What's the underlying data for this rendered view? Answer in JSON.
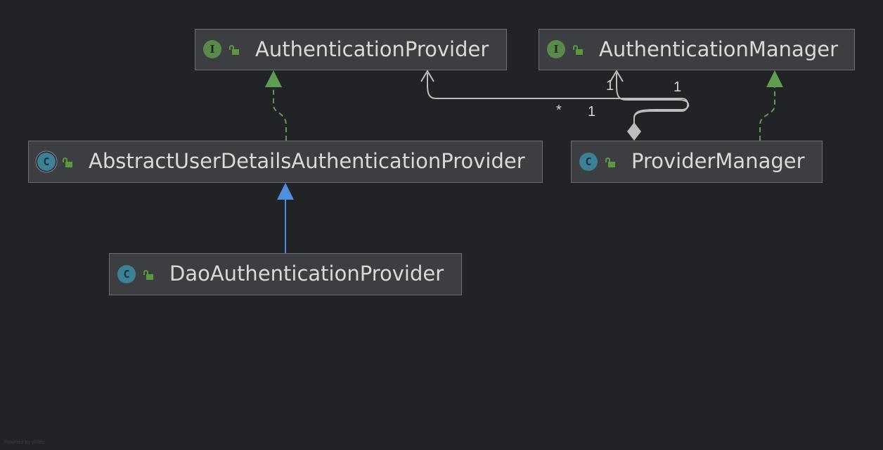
{
  "nodes": {
    "authentication_provider": {
      "kind": "interface",
      "kind_letter": "I",
      "name": "AuthenticationProvider"
    },
    "authentication_manager": {
      "kind": "interface",
      "kind_letter": "I",
      "name": "AuthenticationManager"
    },
    "abstract_user_details_authentication_provider": {
      "kind": "abstract class",
      "kind_letter": "C",
      "name": "AbstractUserDetailsAuthenticationProvider"
    },
    "provider_manager": {
      "kind": "class",
      "kind_letter": "C",
      "name": "ProviderManager"
    },
    "dao_authentication_provider": {
      "kind": "class",
      "kind_letter": "C",
      "name": "DaoAuthenticationProvider"
    }
  },
  "edges": [
    {
      "from": "abstract_user_details_authentication_provider",
      "to": "authentication_provider",
      "type": "realization"
    },
    {
      "from": "provider_manager",
      "to": "authentication_manager",
      "type": "realization"
    },
    {
      "from": "dao_authentication_provider",
      "to": "abstract_user_details_authentication_provider",
      "type": "generalization"
    },
    {
      "from": "provider_manager",
      "to": "authentication_provider",
      "type": "aggregation",
      "source_multiplicity": "1",
      "target_multiplicity": "*"
    },
    {
      "from": "provider_manager",
      "to": "authentication_manager",
      "type": "aggregation",
      "source_multiplicity": "1",
      "target_multiplicity": "1"
    }
  ],
  "multiplicities": {
    "provider_to_ap_star": "*",
    "provider_to_ap_one": "1",
    "parent_one_a": "1",
    "parent_one_b": "1"
  },
  "footer": "Powered by yFiles",
  "colors": {
    "background": "#222326",
    "node_fill": "#3d3e41",
    "node_border": "#6f7073",
    "interface_badge": "#5a8a4a",
    "class_badge": "#3d8196",
    "realization": "#5f9d4e",
    "generalization": "#4f8fe0",
    "association": "#bdbdbd"
  },
  "icons": {
    "interface": "interface-icon",
    "class": "class-icon",
    "abstract": "abstract-class-icon",
    "visibility": "public-lock-icon"
  }
}
